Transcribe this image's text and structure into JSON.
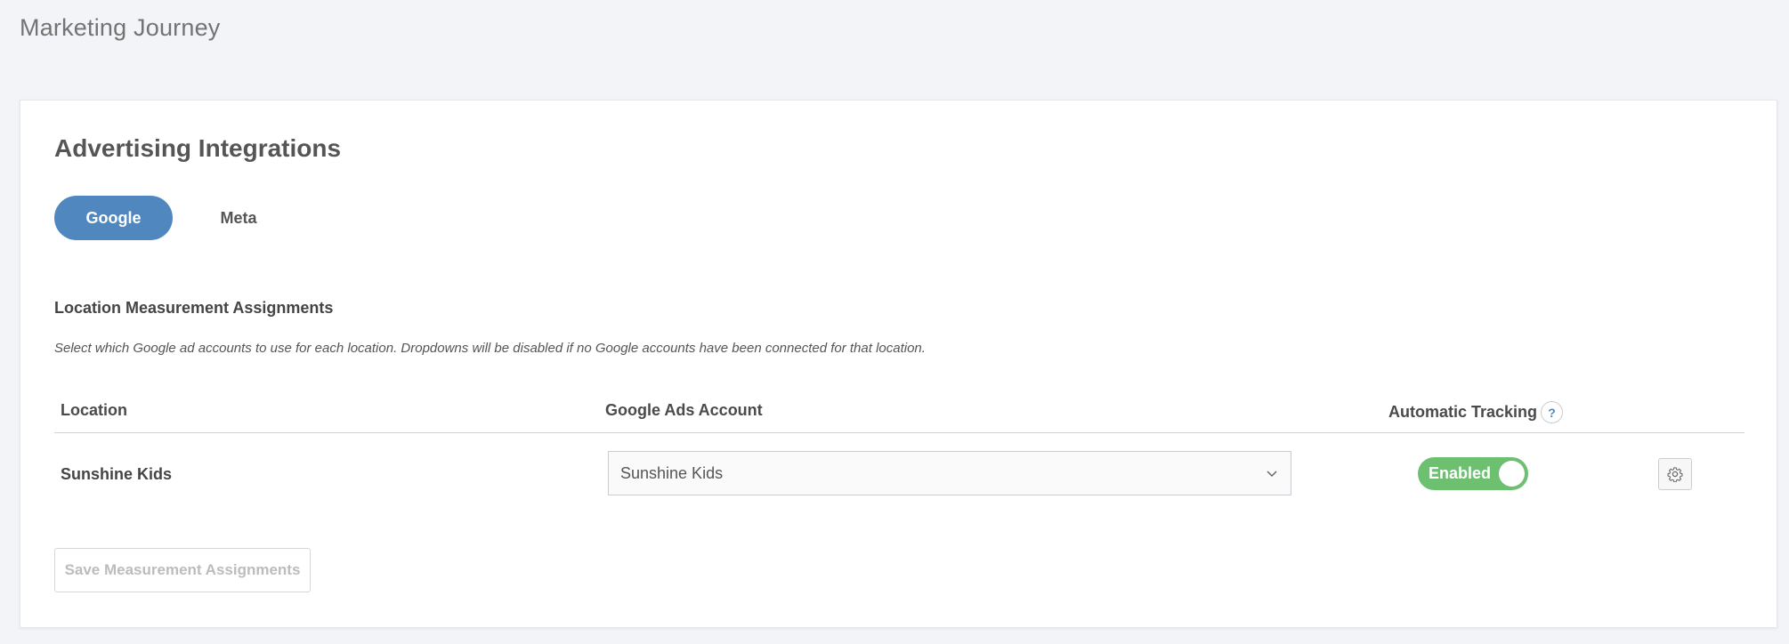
{
  "page": {
    "title": "Marketing Journey"
  },
  "card": {
    "title": "Advertising Integrations",
    "tabs": [
      {
        "label": "Google",
        "active": true
      },
      {
        "label": "Meta",
        "active": false
      }
    ]
  },
  "section": {
    "title": "Location Measurement Assignments",
    "description": "Select which Google ad accounts to use for each location. Dropdowns will be disabled if no Google accounts have been connected for that location."
  },
  "table": {
    "headers": {
      "location": "Location",
      "account": "Google Ads Account",
      "tracking": "Automatic Tracking",
      "help_symbol": "?"
    },
    "rows": [
      {
        "location": "Sunshine Kids",
        "account": "Sunshine Kids",
        "tracking_label": "Enabled",
        "tracking_enabled": true
      }
    ]
  },
  "actions": {
    "save_label": "Save Measurement Assignments",
    "save_disabled": true
  },
  "colors": {
    "accent": "#5187bf",
    "toggle_on": "#6cc070",
    "background": "#f3f4f7"
  },
  "icons": {
    "help": "question-circle-icon",
    "dropdown": "chevron-down-icon",
    "settings": "gear-icon"
  }
}
